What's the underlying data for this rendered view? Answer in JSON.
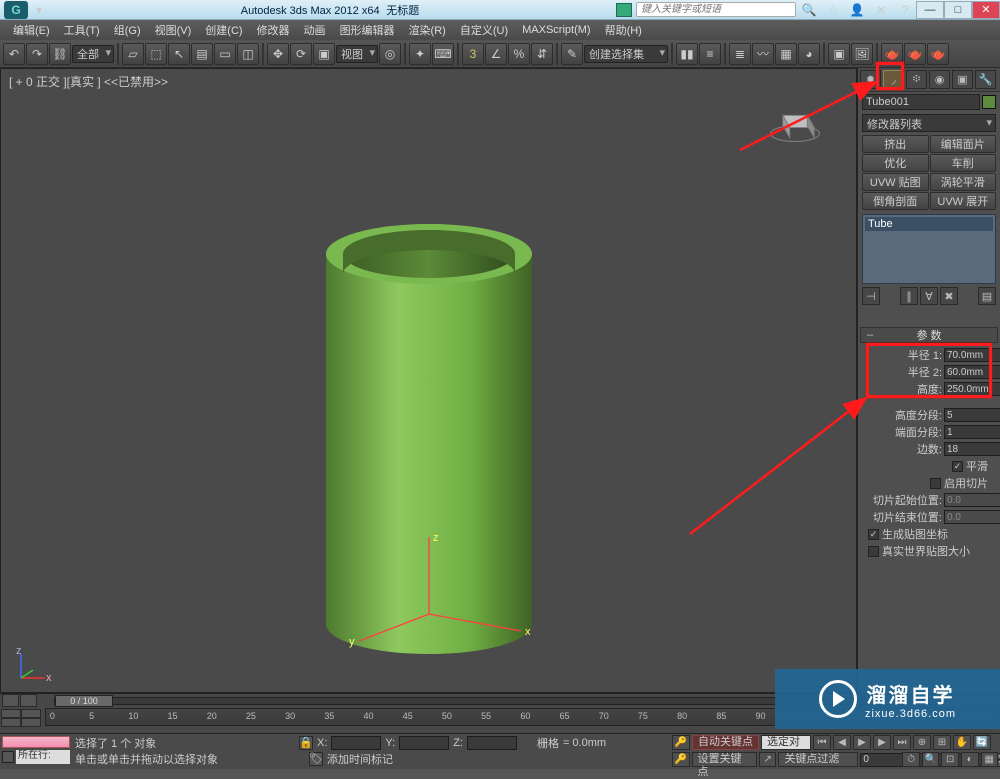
{
  "title_bar": {
    "app": "Autodesk 3ds Max  2012 x64",
    "doc": "无标题",
    "search_placeholder": "键入关键字或短语"
  },
  "menu": [
    "编辑(E)",
    "工具(T)",
    "组(G)",
    "视图(V)",
    "创建(C)",
    "修改器",
    "动画",
    "图形编辑器",
    "渲染(R)",
    "自定义(U)",
    "MAXScript(M)",
    "帮助(H)"
  ],
  "toolbar": {
    "scope": "全部",
    "view": "视图",
    "selset": "创建选择集"
  },
  "viewport": {
    "label": "[ + 0 正交 ][真实 ] <<已禁用>>"
  },
  "cmd": {
    "object_name": "Tube001",
    "modifier_dropdown": "修改器列表",
    "mod_buttons": [
      "挤出",
      "编辑面片",
      "优化",
      "车削",
      "UVW 贴图",
      "涡轮平滑",
      "倒角剖面",
      "UVW 展开"
    ],
    "stack_item": "Tube",
    "rollup_title": "参 数",
    "params": {
      "radius1_label": "半径 1:",
      "radius1": "70.0mm",
      "radius2_label": "半径 2:",
      "radius2": "60.0mm",
      "height_label": "高度:",
      "height": "250.0mm",
      "hseg_label": "高度分段:",
      "hseg": "5",
      "cseg_label": "端面分段:",
      "cseg": "1",
      "sides_label": "边数:",
      "sides": "18",
      "smooth": "平滑",
      "slice_on": "启用切片",
      "slice_from_label": "切片起始位置:",
      "slice_from": "0.0",
      "slice_to_label": "切片结束位置:",
      "slice_to": "0.0",
      "gen_uv": "生成贴图坐标",
      "real_world": "真实世界贴图大小"
    }
  },
  "time": {
    "slider": "0 / 100",
    "ruler": [
      0,
      5,
      10,
      15,
      20,
      25,
      30,
      35,
      40,
      45,
      50,
      55,
      60,
      65,
      70,
      75,
      80,
      85,
      90
    ]
  },
  "status": {
    "location": "所在行:",
    "sel_msg": "选择了 1 个 对象",
    "hint": "单击或单击并拖动以选择对象",
    "add_key": "添加时间标记",
    "grid_label": "栅格",
    "grid_val": "= 0.0mm",
    "autokey": "自动关键点",
    "selset2": "选定对",
    "setkey": "设置关键点",
    "filter": "关键点过滤器..."
  },
  "watermark": {
    "big": "溜溜自学",
    "small": "zixue.3d66.com"
  }
}
